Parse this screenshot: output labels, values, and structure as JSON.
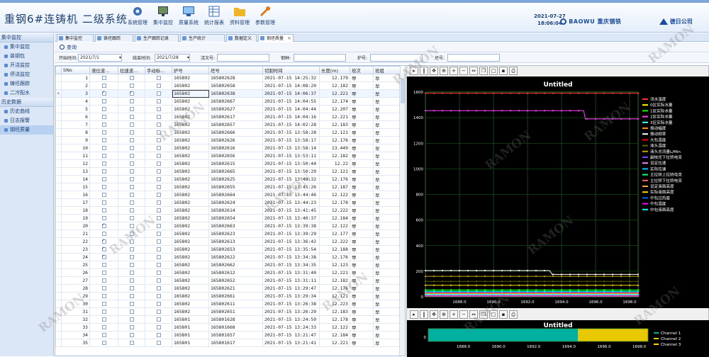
{
  "app": {
    "title": "重钢6#连铸机  二级系统",
    "date": "2021-07-27",
    "time": "18:06:04",
    "brand1": "BAOWU",
    "brand1_cn": "重庆钢铁",
    "brand2": "德日公司"
  },
  "top_menu": [
    {
      "label": "系统管理",
      "icon": "gear-icon"
    },
    {
      "label": "集中监控",
      "icon": "monitor-icon"
    },
    {
      "label": "质量系统",
      "icon": "screen-icon"
    },
    {
      "label": "统计报表",
      "icon": "table-icon"
    },
    {
      "label": "资料管理",
      "icon": "folder-icon"
    },
    {
      "label": "参数管理",
      "icon": "wrench-icon"
    }
  ],
  "sidebar": {
    "group1": "集中监控",
    "items1": [
      "集中监控",
      "装钢包",
      "开浇监控",
      "停浇监控",
      "铸坯跟踪",
      "二冷配水"
    ],
    "group2": "历史数据",
    "items2": [
      "历史曲线",
      "日志报警",
      "钢坯质量"
    ]
  },
  "tabs": [
    {
      "label": "集中监控"
    },
    {
      "label": "铸坯跟踪"
    },
    {
      "label": "生产跟踪记录"
    },
    {
      "label": "生产统计"
    },
    {
      "label": "数据定义"
    },
    {
      "label": "钢坯质量",
      "active": true
    }
  ],
  "toolbar": {
    "query": "查询"
  },
  "filter": {
    "start_label": "开始时间:",
    "start_value": "2021/7/1",
    "end_label": "结束时间:",
    "end_value": "2021/7/28",
    "heat_label": "浇次号:",
    "steel_label": "钢种:",
    "furnace_label": "炉号:",
    "billet_label": "坯号:"
  },
  "table": {
    "columns": [
      "SNo",
      "液位波...",
      "拉速波...",
      "手动标...",
      "炉号",
      "坯号",
      "切割时间",
      "长度(m)",
      "班次",
      "班组"
    ],
    "rows": [
      {
        "sno": "1",
        "lv": false,
        "ls": false,
        "sd": false,
        "furnace": "165802",
        "billet": "165802628",
        "time": "2021-07-15 14:25:32",
        "len": "12.179",
        "shift": "甲",
        "team": "早"
      },
      {
        "sno": "2",
        "lv": false,
        "ls": false,
        "sd": false,
        "furnace": "165802",
        "billet": "165802658",
        "time": "2021-07-15 14:08:20",
        "len": "12.182",
        "shift": "甲",
        "team": "早"
      },
      {
        "sno": "3",
        "lv": true,
        "ls": true,
        "sd": false,
        "furnace": "165802",
        "billet": "165802638",
        "time": "2021-07-15 14:06:37",
        "len": "12.221",
        "shift": "甲",
        "team": "早"
      },
      {
        "sno": "4",
        "lv": false,
        "ls": false,
        "sd": false,
        "furnace": "165802",
        "billet": "165802667",
        "time": "2021-07-15 14:04:55",
        "len": "12.174",
        "shift": "甲",
        "team": "早"
      },
      {
        "sno": "5",
        "lv": false,
        "ls": false,
        "sd": false,
        "furnace": "165802",
        "billet": "165802627",
        "time": "2021-07-15 14:04:44",
        "len": "12.207",
        "shift": "甲",
        "team": "早"
      },
      {
        "sno": "6",
        "lv": false,
        "ls": false,
        "sd": false,
        "furnace": "165802",
        "billet": "165802617",
        "time": "2021-07-15 14:04:16",
        "len": "12.221",
        "shift": "甲",
        "team": "早"
      },
      {
        "sno": "7",
        "lv": false,
        "ls": false,
        "sd": false,
        "furnace": "165802",
        "billet": "165802657",
        "time": "2021-07-15 14:02:28",
        "len": "12.183",
        "shift": "甲",
        "team": "早"
      },
      {
        "sno": "8",
        "lv": false,
        "ls": false,
        "sd": false,
        "furnace": "165802",
        "billet": "165802666",
        "time": "2021-07-15 13:58:28",
        "len": "12.121",
        "shift": "甲",
        "team": "早"
      },
      {
        "sno": "9",
        "lv": false,
        "ls": false,
        "sd": false,
        "furnace": "165802",
        "billet": "165802626",
        "time": "2021-07-15 13:58:17",
        "len": "12.176",
        "shift": "甲",
        "team": "早"
      },
      {
        "sno": "10",
        "lv": false,
        "ls": false,
        "sd": false,
        "furnace": "165802",
        "billet": "165802616",
        "time": "2021-07-15 13:58:14",
        "len": "13.449",
        "shift": "甲",
        "team": "早"
      },
      {
        "sno": "11",
        "lv": false,
        "ls": false,
        "sd": false,
        "furnace": "165802",
        "billet": "165802656",
        "time": "2021-07-15 13:53:11",
        "len": "12.182",
        "shift": "甲",
        "team": "早"
      },
      {
        "sno": "12",
        "lv": false,
        "ls": false,
        "sd": false,
        "furnace": "165802",
        "billet": "165802615",
        "time": "2021-07-15 13:50:44",
        "len": "12.22",
        "shift": "甲",
        "team": "早"
      },
      {
        "sno": "13",
        "lv": false,
        "ls": false,
        "sd": false,
        "furnace": "165802",
        "billet": "165802665",
        "time": "2021-07-15 13:50:29",
        "len": "12.121",
        "shift": "甲",
        "team": "早"
      },
      {
        "sno": "14",
        "lv": false,
        "ls": false,
        "sd": false,
        "furnace": "165802",
        "billet": "165802625",
        "time": "2021-07-15 13:49:32",
        "len": "12.176",
        "shift": "甲",
        "team": "早"
      },
      {
        "sno": "15",
        "lv": false,
        "ls": false,
        "sd": false,
        "furnace": "165802",
        "billet": "165802655",
        "time": "2021-07-15 13:45:26",
        "len": "12.187",
        "shift": "甲",
        "team": "早"
      },
      {
        "sno": "16",
        "lv": false,
        "ls": false,
        "sd": false,
        "furnace": "165802",
        "billet": "165802664",
        "time": "2021-07-15 13:44:46",
        "len": "12.122",
        "shift": "甲",
        "team": "早"
      },
      {
        "sno": "17",
        "lv": false,
        "ls": false,
        "sd": false,
        "furnace": "165802",
        "billet": "165802624",
        "time": "2021-07-15 13:44:23",
        "len": "12.178",
        "shift": "甲",
        "team": "早"
      },
      {
        "sno": "18",
        "lv": false,
        "ls": false,
        "sd": false,
        "furnace": "165802",
        "billet": "165802614",
        "time": "2021-07-15 13:41:45",
        "len": "12.222",
        "shift": "甲",
        "team": "早"
      },
      {
        "sno": "19",
        "lv": false,
        "ls": false,
        "sd": false,
        "furnace": "165802",
        "billet": "165802654",
        "time": "2021-07-15 13:40:37",
        "len": "12.184",
        "shift": "甲",
        "team": "早"
      },
      {
        "sno": "20",
        "lv": true,
        "ls": false,
        "sd": false,
        "furnace": "165802",
        "billet": "165802663",
        "time": "2021-07-15 13:39:38",
        "len": "12.122",
        "shift": "甲",
        "team": "早"
      },
      {
        "sno": "21",
        "lv": false,
        "ls": false,
        "sd": false,
        "furnace": "165802",
        "billet": "165802623",
        "time": "2021-07-15 13:39:29",
        "len": "12.177",
        "shift": "甲",
        "team": "早"
      },
      {
        "sno": "22",
        "lv": true,
        "ls": false,
        "sd": false,
        "furnace": "165802",
        "billet": "165802613",
        "time": "2021-07-15 13:36:42",
        "len": "12.222",
        "shift": "甲",
        "team": "早"
      },
      {
        "sno": "23",
        "lv": true,
        "ls": false,
        "sd": false,
        "furnace": "165802",
        "billet": "165802653",
        "time": "2021-07-15 13:35:54",
        "len": "12.188",
        "shift": "甲",
        "team": "早"
      },
      {
        "sno": "24",
        "lv": true,
        "ls": false,
        "sd": false,
        "furnace": "165802",
        "billet": "165802622",
        "time": "2021-07-15 13:34:38",
        "len": "12.176",
        "shift": "甲",
        "team": "早"
      },
      {
        "sno": "25",
        "lv": false,
        "ls": false,
        "sd": false,
        "furnace": "165802",
        "billet": "165802662",
        "time": "2021-07-15 13:34:35",
        "len": "12.123",
        "shift": "甲",
        "team": "早"
      },
      {
        "sno": "26",
        "lv": false,
        "ls": false,
        "sd": false,
        "furnace": "165802",
        "billet": "165802612",
        "time": "2021-07-15 13:31:40",
        "len": "12.221",
        "shift": "甲",
        "team": "早"
      },
      {
        "sno": "27",
        "lv": false,
        "ls": false,
        "sd": false,
        "furnace": "165802",
        "billet": "165802652",
        "time": "2021-07-15 13:31:11",
        "len": "12.182",
        "shift": "甲",
        "team": "早"
      },
      {
        "sno": "28",
        "lv": false,
        "ls": false,
        "sd": false,
        "furnace": "165802",
        "billet": "165802621",
        "time": "2021-07-15 13:29:47",
        "len": "12.176",
        "shift": "甲",
        "team": "早"
      },
      {
        "sno": "29",
        "lv": false,
        "ls": false,
        "sd": false,
        "furnace": "165802",
        "billet": "165802661",
        "time": "2021-07-15 13:29:34",
        "len": "12.121",
        "shift": "甲",
        "team": "早"
      },
      {
        "sno": "30",
        "lv": false,
        "ls": false,
        "sd": false,
        "furnace": "165802",
        "billet": "165802611",
        "time": "2021-07-15 13:26:38",
        "len": "12.223",
        "shift": "甲",
        "team": "早"
      },
      {
        "sno": "31",
        "lv": false,
        "ls": false,
        "sd": false,
        "furnace": "165802",
        "billet": "165802651",
        "time": "2021-07-15 13:26:29",
        "len": "12.183",
        "shift": "甲",
        "team": "早"
      },
      {
        "sno": "32",
        "lv": false,
        "ls": false,
        "sd": false,
        "furnace": "165801",
        "billet": "165801628",
        "time": "2021-07-15 13:24:59",
        "len": "12.178",
        "shift": "甲",
        "team": "早"
      },
      {
        "sno": "33",
        "lv": false,
        "ls": false,
        "sd": false,
        "furnace": "165801",
        "billet": "165801668",
        "time": "2021-07-15 13:24:33",
        "len": "12.122",
        "shift": "甲",
        "team": "早"
      },
      {
        "sno": "34",
        "lv": false,
        "ls": false,
        "sd": false,
        "furnace": "165801",
        "billet": "165801657",
        "time": "2021-07-15 13:21:47",
        "len": "12.184",
        "shift": "甲",
        "team": "早"
      },
      {
        "sno": "35",
        "lv": false,
        "ls": false,
        "sd": false,
        "furnace": "165801",
        "billet": "165801617",
        "time": "2021-07-15 13:21:41",
        "len": "12.221",
        "shift": "甲",
        "team": "早"
      }
    ]
  },
  "chart_data": [
    {
      "type": "line",
      "title": "Untitled",
      "ylim": [
        0,
        1600
      ],
      "xlim": [
        1686,
        1698.5
      ],
      "x_ticks": [
        "1688.0",
        "1690.0",
        "1692.0",
        "1694.0",
        "1696.0",
        "1698.0"
      ],
      "y_ticks": [
        "0",
        "200",
        "400",
        "600",
        "800",
        "1000",
        "1200",
        "1400",
        "1600"
      ],
      "grid": true,
      "legend_position": "right",
      "series": [
        {
          "name": "浇水温度",
          "color": "#ff3030",
          "x": [
            1686,
            1698.5
          ],
          "y": [
            1590,
            1590
          ]
        },
        {
          "name": "0区实际水量",
          "color": "#ffff00",
          "x": [
            1686,
            1698.5
          ],
          "y": [
            5,
            5
          ]
        },
        {
          "name": "1区实际水量",
          "color": "#00ff00",
          "x": [
            1686,
            1698.5
          ],
          "y": [
            55,
            55
          ]
        },
        {
          "name": "2区实际水量",
          "color": "#ff40ff",
          "x": [
            1686,
            1695.3,
            1695.4,
            1698.5
          ],
          "y": [
            1455,
            1455,
            1390,
            1390
          ]
        },
        {
          "name": "3区实际水量",
          "color": "#40ffff",
          "x": [
            1686,
            1698.5
          ],
          "y": [
            20,
            20
          ]
        },
        {
          "name": "振动幅度",
          "color": "#ff8c00",
          "x": [
            1686,
            1698.5
          ],
          "y": [
            25,
            25
          ]
        },
        {
          "name": "振动频率",
          "color": "#ffffff",
          "x": [
            1686,
            1693.3,
            1693.45,
            1698.5
          ],
          "y": [
            205,
            205,
            175,
            175
          ]
        },
        {
          "name": "大包温度",
          "color": "#ff0000",
          "x": [
            1686,
            1698.5
          ],
          "y": [
            10,
            10
          ]
        },
        {
          "name": "液头温度",
          "color": "#606000",
          "x": [
            1686,
            1698.5
          ],
          "y": [
            120,
            120
          ]
        },
        {
          "name": "液头总流量L/Min",
          "color": "#c0a000",
          "x": [
            1686,
            1698.5
          ],
          "y": [
            160,
            160
          ]
        },
        {
          "name": "副枝坯下拉矫电流",
          "color": "#8040ff",
          "x": [
            1686,
            1698.5
          ],
          "y": [
            35,
            35
          ]
        },
        {
          "name": "设定拉速",
          "color": "#ff80ff",
          "x": [
            1686,
            1698.5
          ],
          "y": [
            15,
            15
          ]
        },
        {
          "name": "实际拉速",
          "color": "#00c0ff",
          "x": [
            1686,
            1698.5
          ],
          "y": [
            40,
            40
          ]
        },
        {
          "name": "主拉矫上拉矫电流",
          "color": "#00ff80",
          "x": [
            1686,
            1698.5
          ],
          "y": [
            45,
            45
          ]
        },
        {
          "name": "主拉矫下拉矫电流",
          "color": "#ff6060",
          "x": [
            1686,
            1698.5
          ],
          "y": [
            30,
            30
          ]
        },
        {
          "name": "设定液面高度",
          "color": "#ffa040",
          "x": [
            1686,
            1698.5
          ],
          "y": [
            12,
            12
          ]
        },
        {
          "name": "实际液面高度",
          "color": "#ffd700",
          "x": [
            1686,
            1698.5
          ],
          "y": [
            90,
            90
          ]
        },
        {
          "name": "中包过热度",
          "color": "#0060ff",
          "x": [
            1686,
            1698.5
          ],
          "y": [
            8,
            8
          ]
        },
        {
          "name": "中包温度",
          "color": "#ff00ff",
          "x": [
            1686,
            1698.5
          ],
          "y": [
            6,
            6
          ]
        },
        {
          "name": "中包液面高度",
          "color": "#00ffff",
          "x": [
            1686,
            1698.5
          ],
          "y": [
            18,
            18
          ]
        }
      ]
    },
    {
      "type": "area",
      "title": "Untitled",
      "xlim": [
        1686,
        1698.5
      ],
      "x_ticks": [
        "1688.0",
        "1690.0",
        "1692.0",
        "1694.0",
        "1696.0",
        "1698.0"
      ],
      "y_ticks": [
        "0"
      ],
      "legend_position": "right",
      "series": [
        {
          "name": "Channel 1",
          "color": "#00b0a0",
          "x": [
            1686,
            1694.5
          ],
          "y": [
            1,
            1
          ]
        },
        {
          "name": "Channel 2",
          "color": "#e8c800",
          "x": [
            1694.5,
            1698.5
          ],
          "y": [
            1,
            1
          ]
        },
        {
          "name": "Channel 3",
          "color": "#ffd700",
          "x": [],
          "y": []
        }
      ]
    }
  ],
  "watermark": "RAMON"
}
